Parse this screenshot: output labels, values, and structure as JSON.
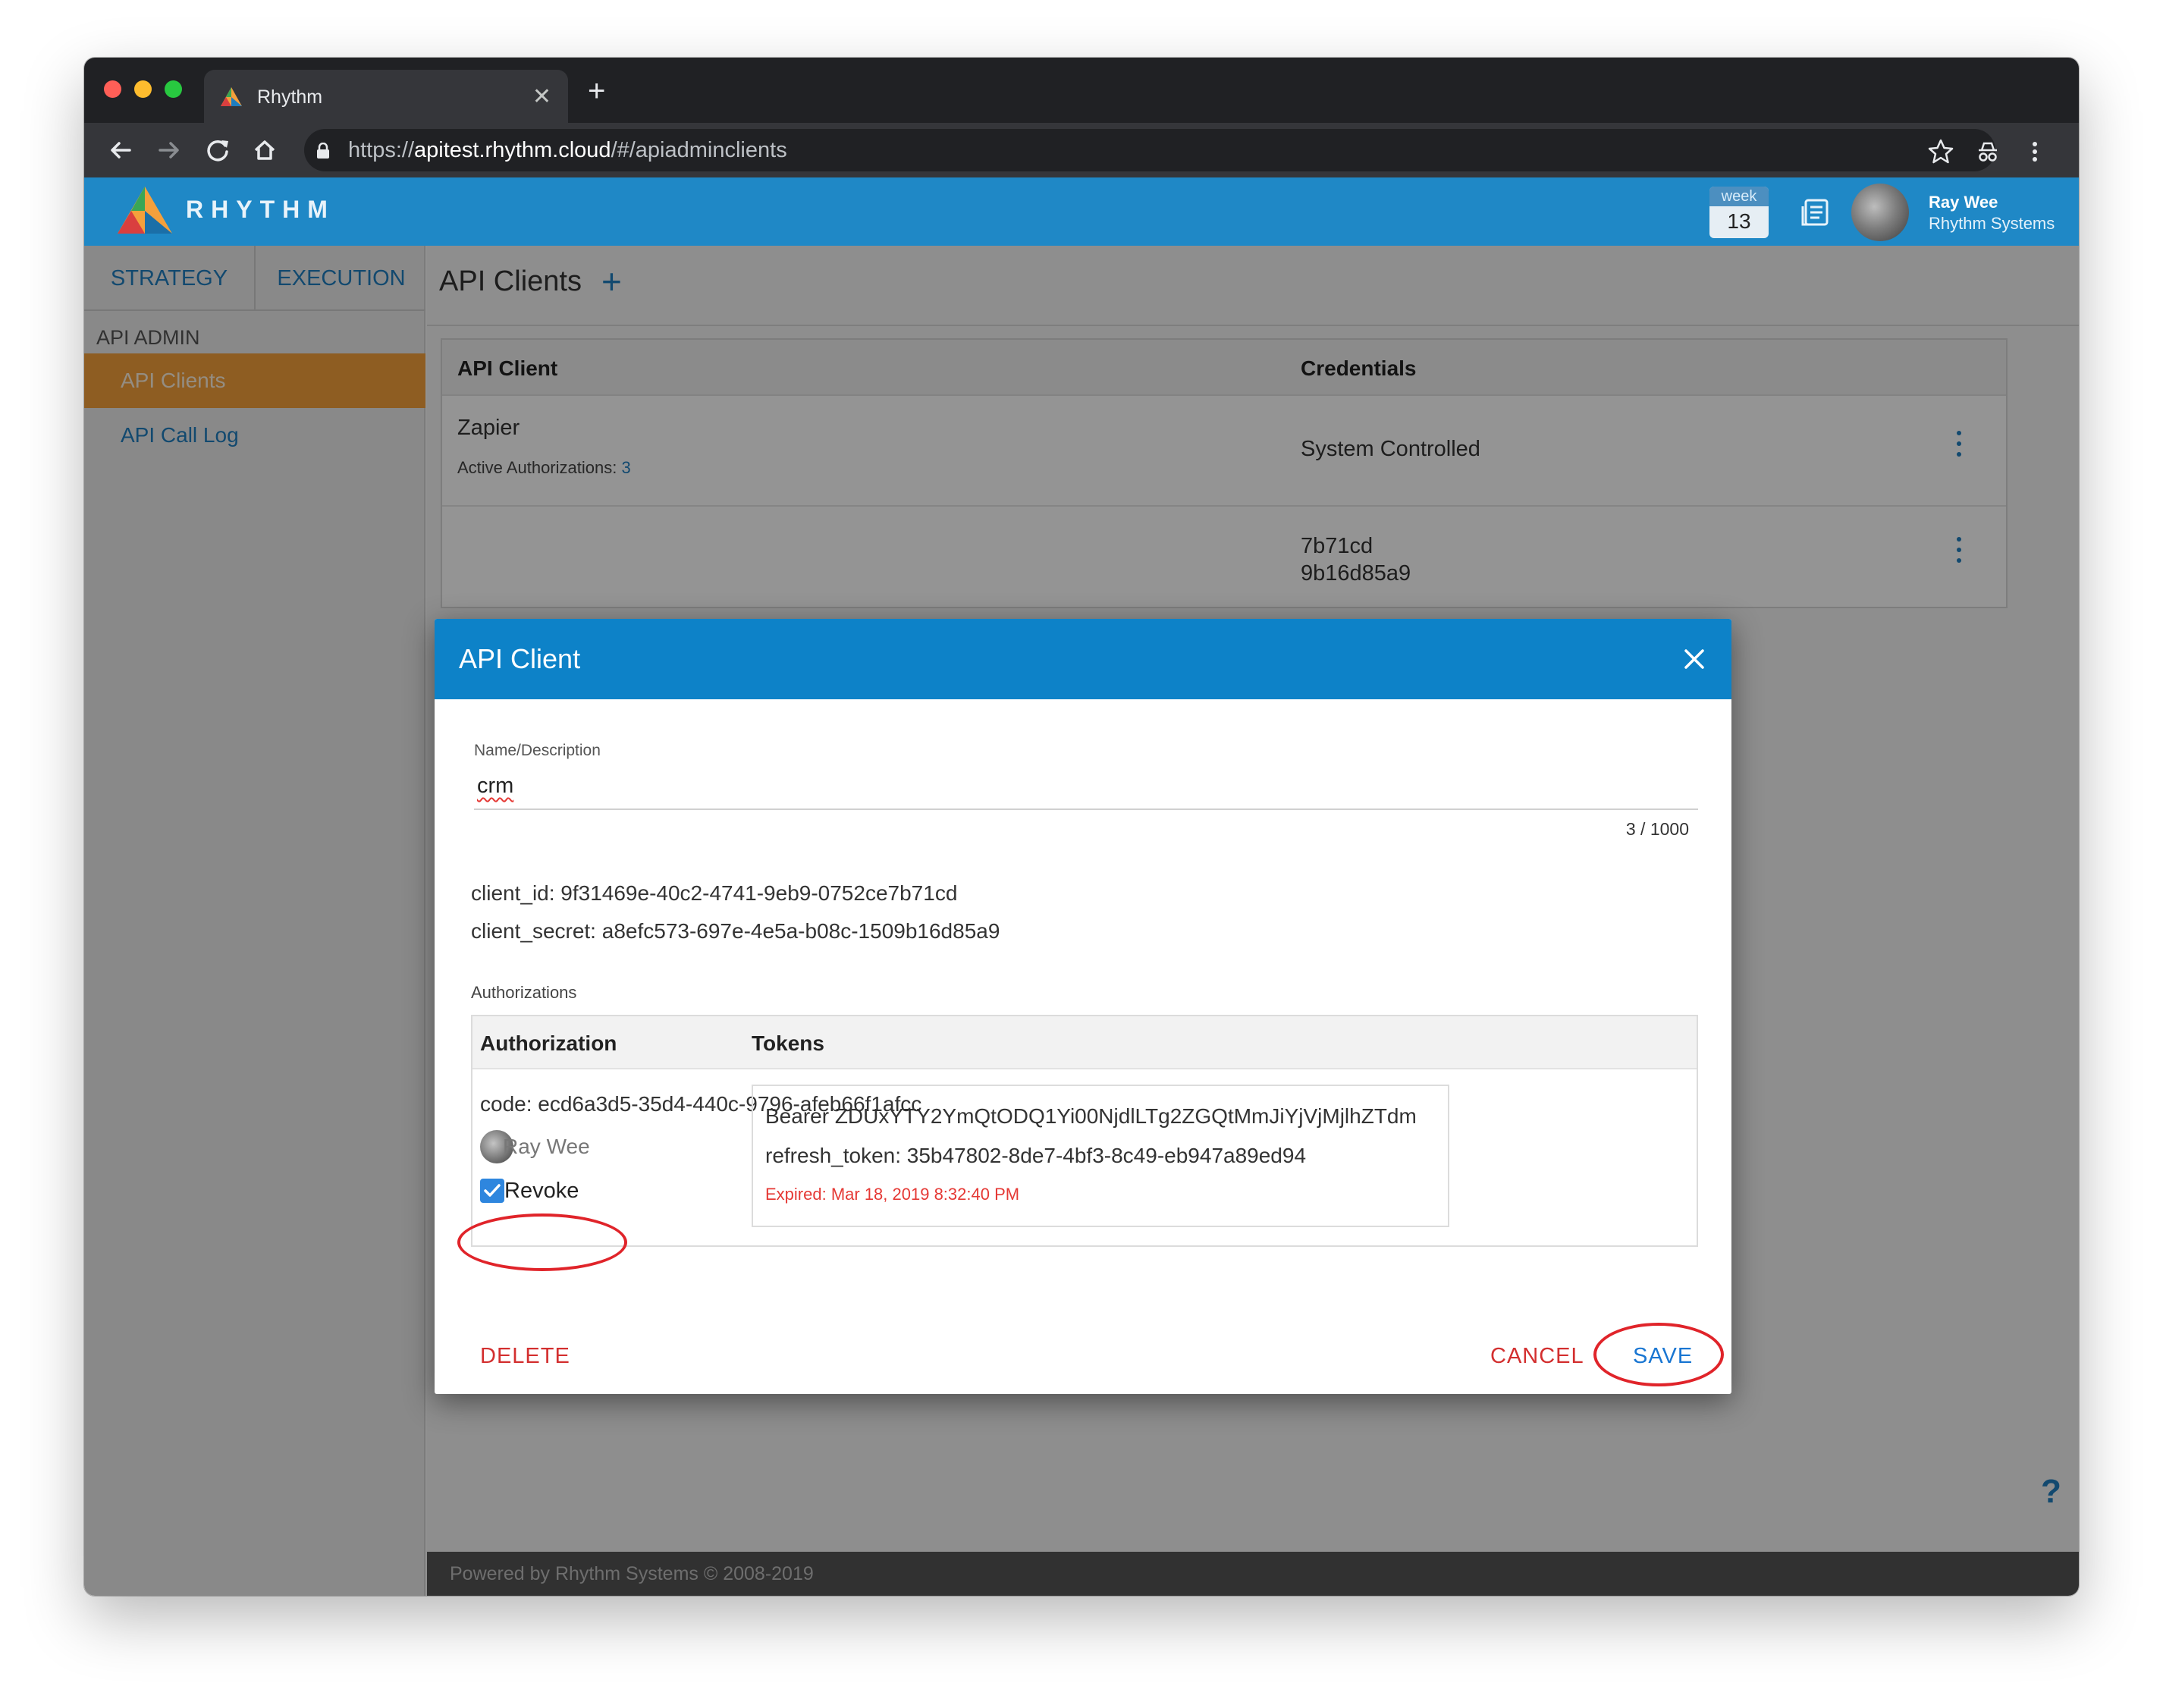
{
  "browser": {
    "tab_title": "Rhythm",
    "url_scheme": "https://",
    "url_host": "apitest.rhythm.cloud",
    "url_path": "/#/apiadminclients"
  },
  "header": {
    "brand": "RHYTHM",
    "week_label": "week",
    "week_number": "13",
    "user_name": "Ray Wee",
    "user_org": "Rhythm Systems"
  },
  "sidebar": {
    "tabs": [
      {
        "label": "STRATEGY"
      },
      {
        "label": "EXECUTION"
      }
    ],
    "section": "API ADMIN",
    "items": [
      {
        "label": "API Clients",
        "active": true
      },
      {
        "label": "API Call Log",
        "active": false
      }
    ]
  },
  "main": {
    "title": "API Clients",
    "add": "+",
    "columns": [
      "API Client",
      "Credentials"
    ],
    "rows": [
      {
        "name": "Zapier",
        "sub_label": "Active Authorizations",
        "sub_value": "3",
        "credentials": "System Controlled"
      },
      {
        "cred_line1": "7b71cd",
        "cred_line2": "9b16d85a9"
      }
    ],
    "footer": "Powered by Rhythm Systems © 2008-2019",
    "help": "?"
  },
  "modal": {
    "title": "API Client",
    "field_label": "Name/Description",
    "field_value": "crm",
    "char_count": "3 / 1000",
    "client_id": "client_id: 9f31469e-40c2-4741-9eb9-0752ce7b71cd",
    "client_secret": "client_secret: a8efc573-697e-4e5a-b08c-1509b16d85a9",
    "auth_section": "Authorizations",
    "auth_columns": [
      "Authorization",
      "Tokens"
    ],
    "authorization": {
      "code": "code: ecd6a3d5-35d4-440c-9796-afeb66f1afcc",
      "user": "Ray Wee",
      "revoke_label": "Revoke",
      "revoke_checked": true
    },
    "tokens": {
      "bearer": "Bearer ZDUxYTY2YmQtODQ1Yi00NjdlLTg2ZGQtMmJiYjVjMjlhZTdm",
      "refresh": "refresh_token: 35b47802-8de7-4bf3-8c49-eb947a89ed94",
      "expired": "Expired: Mar 18, 2019 8:32:40 PM"
    },
    "buttons": {
      "delete": "DELETE",
      "cancel": "CANCEL",
      "save": "SAVE"
    }
  },
  "colors": {
    "header_blue": "#1f88c6",
    "modal_blue": "#0d82c8",
    "active_orange": "#f4a03c",
    "danger_red": "#d32f2f",
    "annotation_red": "#e0242a"
  }
}
